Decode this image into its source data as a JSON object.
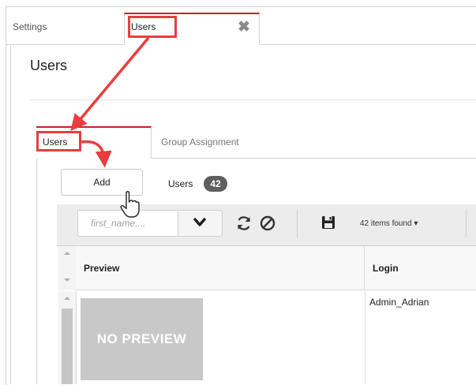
{
  "tabs": {
    "settings": "Settings",
    "users": "Users"
  },
  "page": {
    "title": "Users"
  },
  "inner_tabs": {
    "users": "Users",
    "group_assignment": "Group Assignment"
  },
  "actions": {
    "add_label": "Add",
    "users_label": "Users",
    "users_count": "42"
  },
  "toolbar": {
    "filter_placeholder": "first_name,...",
    "items_found": "42 items found ▾"
  },
  "table": {
    "columns": [
      "Preview",
      "Login"
    ],
    "rows": [
      {
        "preview": "NO PREVIEW",
        "login": "Admin_Adrian"
      }
    ]
  },
  "colors": {
    "accent": "#c8202d",
    "annotation": "#e83e3e"
  }
}
